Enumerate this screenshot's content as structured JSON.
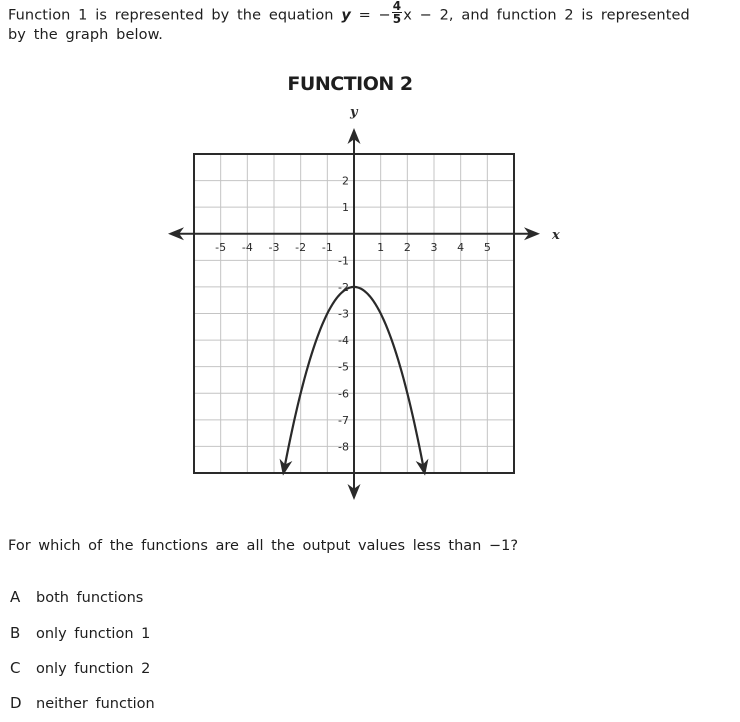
{
  "intro": {
    "prefix": "Function 1 is represented by the equation ",
    "y_var": "y",
    "equals": " = −",
    "frac_num": "4",
    "frac_den": "5",
    "suffix": "x − 2, and function 2 is represented",
    "line2": "by the graph below."
  },
  "question": "For which of the functions are all the output values less than −1?",
  "choices": [
    {
      "letter": "A",
      "text": "both functions"
    },
    {
      "letter": "B",
      "text": "only function 1"
    },
    {
      "letter": "C",
      "text": "only function 2"
    },
    {
      "letter": "D",
      "text": "neither function"
    }
  ],
  "chart_data": {
    "type": "line",
    "title": "FUNCTION 2",
    "xlabel": "x",
    "ylabel": "y",
    "xlim": [
      -6,
      6
    ],
    "ylim": [
      -9,
      3
    ],
    "grid": true,
    "x_ticks": [
      "-5",
      "-4",
      "-3",
      "-2",
      "-1",
      "1",
      "2",
      "3",
      "4",
      "5"
    ],
    "x_tick_values": [
      -5,
      -4,
      -3,
      -2,
      -1,
      1,
      2,
      3,
      4,
      5
    ],
    "y_ticks": [
      "2",
      "1",
      "-1",
      "-2",
      "-3",
      "-4",
      "-5",
      "-6",
      "-7",
      "-8"
    ],
    "y_tick_values": [
      2,
      1,
      -1,
      -2,
      -3,
      -4,
      -5,
      -6,
      -7,
      -8
    ],
    "series": [
      {
        "name": "Function 2",
        "equation": "y = -x^2 - 2",
        "vertex": [
          0,
          -2
        ],
        "x_range": [
          -2.65,
          2.65
        ],
        "arrows_at_ends": true
      }
    ]
  }
}
